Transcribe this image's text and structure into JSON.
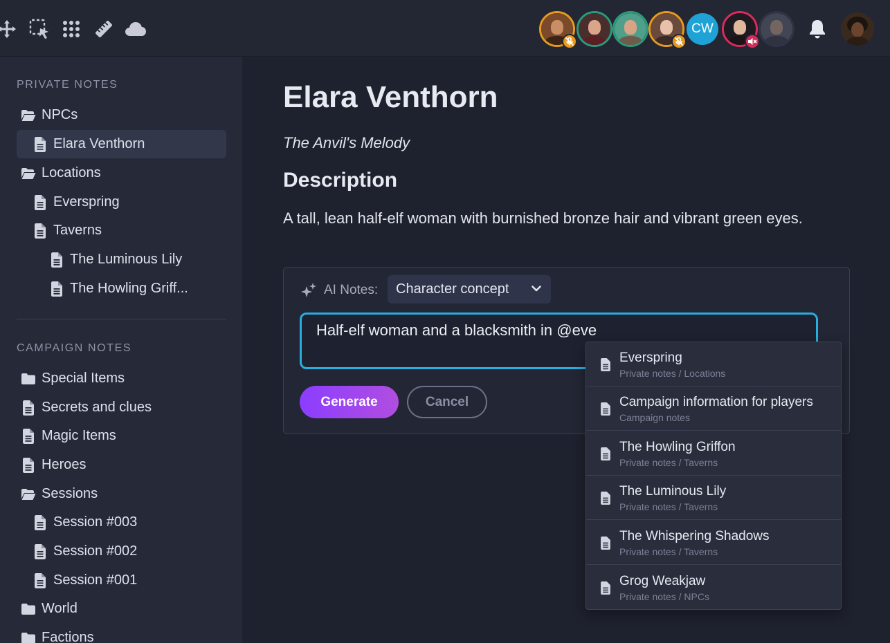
{
  "toolbar": {
    "tools": [
      "move-icon",
      "select-icon",
      "grid-icon",
      "ruler-icon",
      "cloud-icon"
    ]
  },
  "participants": {
    "initials_avatar": "CW",
    "accent_ring": "#e79a1d",
    "initials_color": "#1fa3d6",
    "mute_badge_orange": "#e79a1d",
    "mute_badge_red": "#d92b5a"
  },
  "sidebar": {
    "private_title": "PRIVATE NOTES",
    "private_items": [
      {
        "label": "NPCs",
        "icon": "folder-open-icon"
      },
      {
        "label": "Elara Venthorn",
        "icon": "document-icon"
      },
      {
        "label": "Locations",
        "icon": "folder-open-icon"
      },
      {
        "label": "Everspring",
        "icon": "document-icon"
      },
      {
        "label": "Taverns",
        "icon": "document-icon"
      },
      {
        "label": "The Luminous Lily",
        "icon": "document-icon"
      },
      {
        "label": "The Howling Griff...",
        "icon": "document-icon"
      }
    ],
    "campaign_title": "CAMPAIGN NOTES",
    "campaign_items": [
      {
        "label": "Special Items",
        "icon": "folder-icon"
      },
      {
        "label": "Secrets and clues",
        "icon": "document-icon"
      },
      {
        "label": "Magic Items",
        "icon": "document-icon"
      },
      {
        "label": "Heroes",
        "icon": "document-icon"
      },
      {
        "label": "Sessions",
        "icon": "folder-open-icon"
      },
      {
        "label": "Session #003",
        "icon": "document-icon"
      },
      {
        "label": "Session #002",
        "icon": "document-icon"
      },
      {
        "label": "Session #001",
        "icon": "document-icon"
      },
      {
        "label": "World",
        "icon": "folder-icon"
      },
      {
        "label": "Factions",
        "icon": "folder-icon"
      }
    ]
  },
  "note": {
    "title": "Elara Venthorn",
    "subtitle": "The Anvil's Melody",
    "section_heading": "Description",
    "description": "A tall, lean half-elf woman with burnished bronze hair and vibrant green eyes."
  },
  "ai_notes": {
    "label": "AI Notes:",
    "selected_option": "Character concept",
    "input_value": "Half-elf woman and a blacksmith in @eve",
    "generate_label": "Generate",
    "cancel_label": "Cancel"
  },
  "mention_suggestions": [
    {
      "title": "Everspring",
      "path": "Private notes / Locations"
    },
    {
      "title": "Campaign information for players",
      "path": "Campaign notes"
    },
    {
      "title": "The Howling Griffon",
      "path": "Private notes / Taverns"
    },
    {
      "title": "The Luminous Lily",
      "path": "Private notes / Taverns"
    },
    {
      "title": "The Whispering Shadows",
      "path": "Private notes / Taverns"
    },
    {
      "title": "Grog Weakjaw",
      "path": "Private notes / NPCs"
    }
  ]
}
